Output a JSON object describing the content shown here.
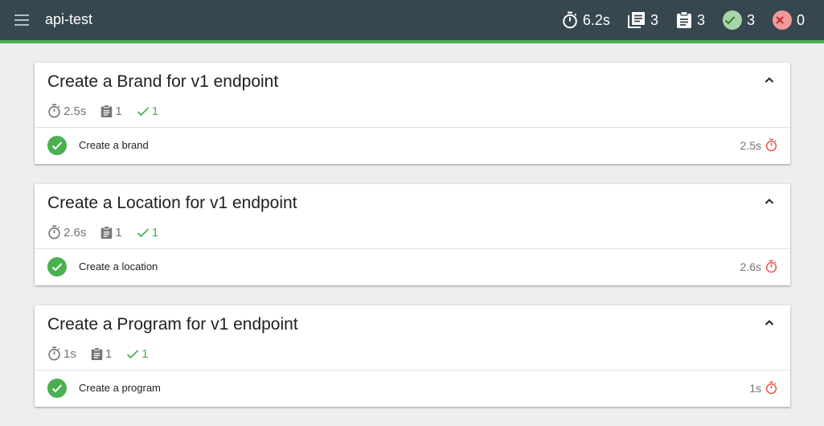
{
  "app": {
    "title": "api-test"
  },
  "header_stats": {
    "duration": "6.2s",
    "suites": "3",
    "tests": "3",
    "passed": "3",
    "failed": "0"
  },
  "colors": {
    "topbar": "#37474f",
    "accent": "#4caf50",
    "pass": "#4caf50",
    "slow": "#ef5350"
  },
  "suites": [
    {
      "title": "Create a Brand for v1 endpoint",
      "duration": "2.5s",
      "tests_count": "1",
      "passed_count": "1",
      "tests": [
        {
          "name": "Create a brand",
          "duration": "2.5s",
          "status": "passed"
        }
      ]
    },
    {
      "title": "Create a Location for v1 endpoint",
      "duration": "2.6s",
      "tests_count": "1",
      "passed_count": "1",
      "tests": [
        {
          "name": "Create a location",
          "duration": "2.6s",
          "status": "passed"
        }
      ]
    },
    {
      "title": "Create a Program for v1 endpoint",
      "duration": "1s",
      "tests_count": "1",
      "passed_count": "1",
      "tests": [
        {
          "name": "Create a program",
          "duration": "1s",
          "status": "passed"
        }
      ]
    }
  ]
}
